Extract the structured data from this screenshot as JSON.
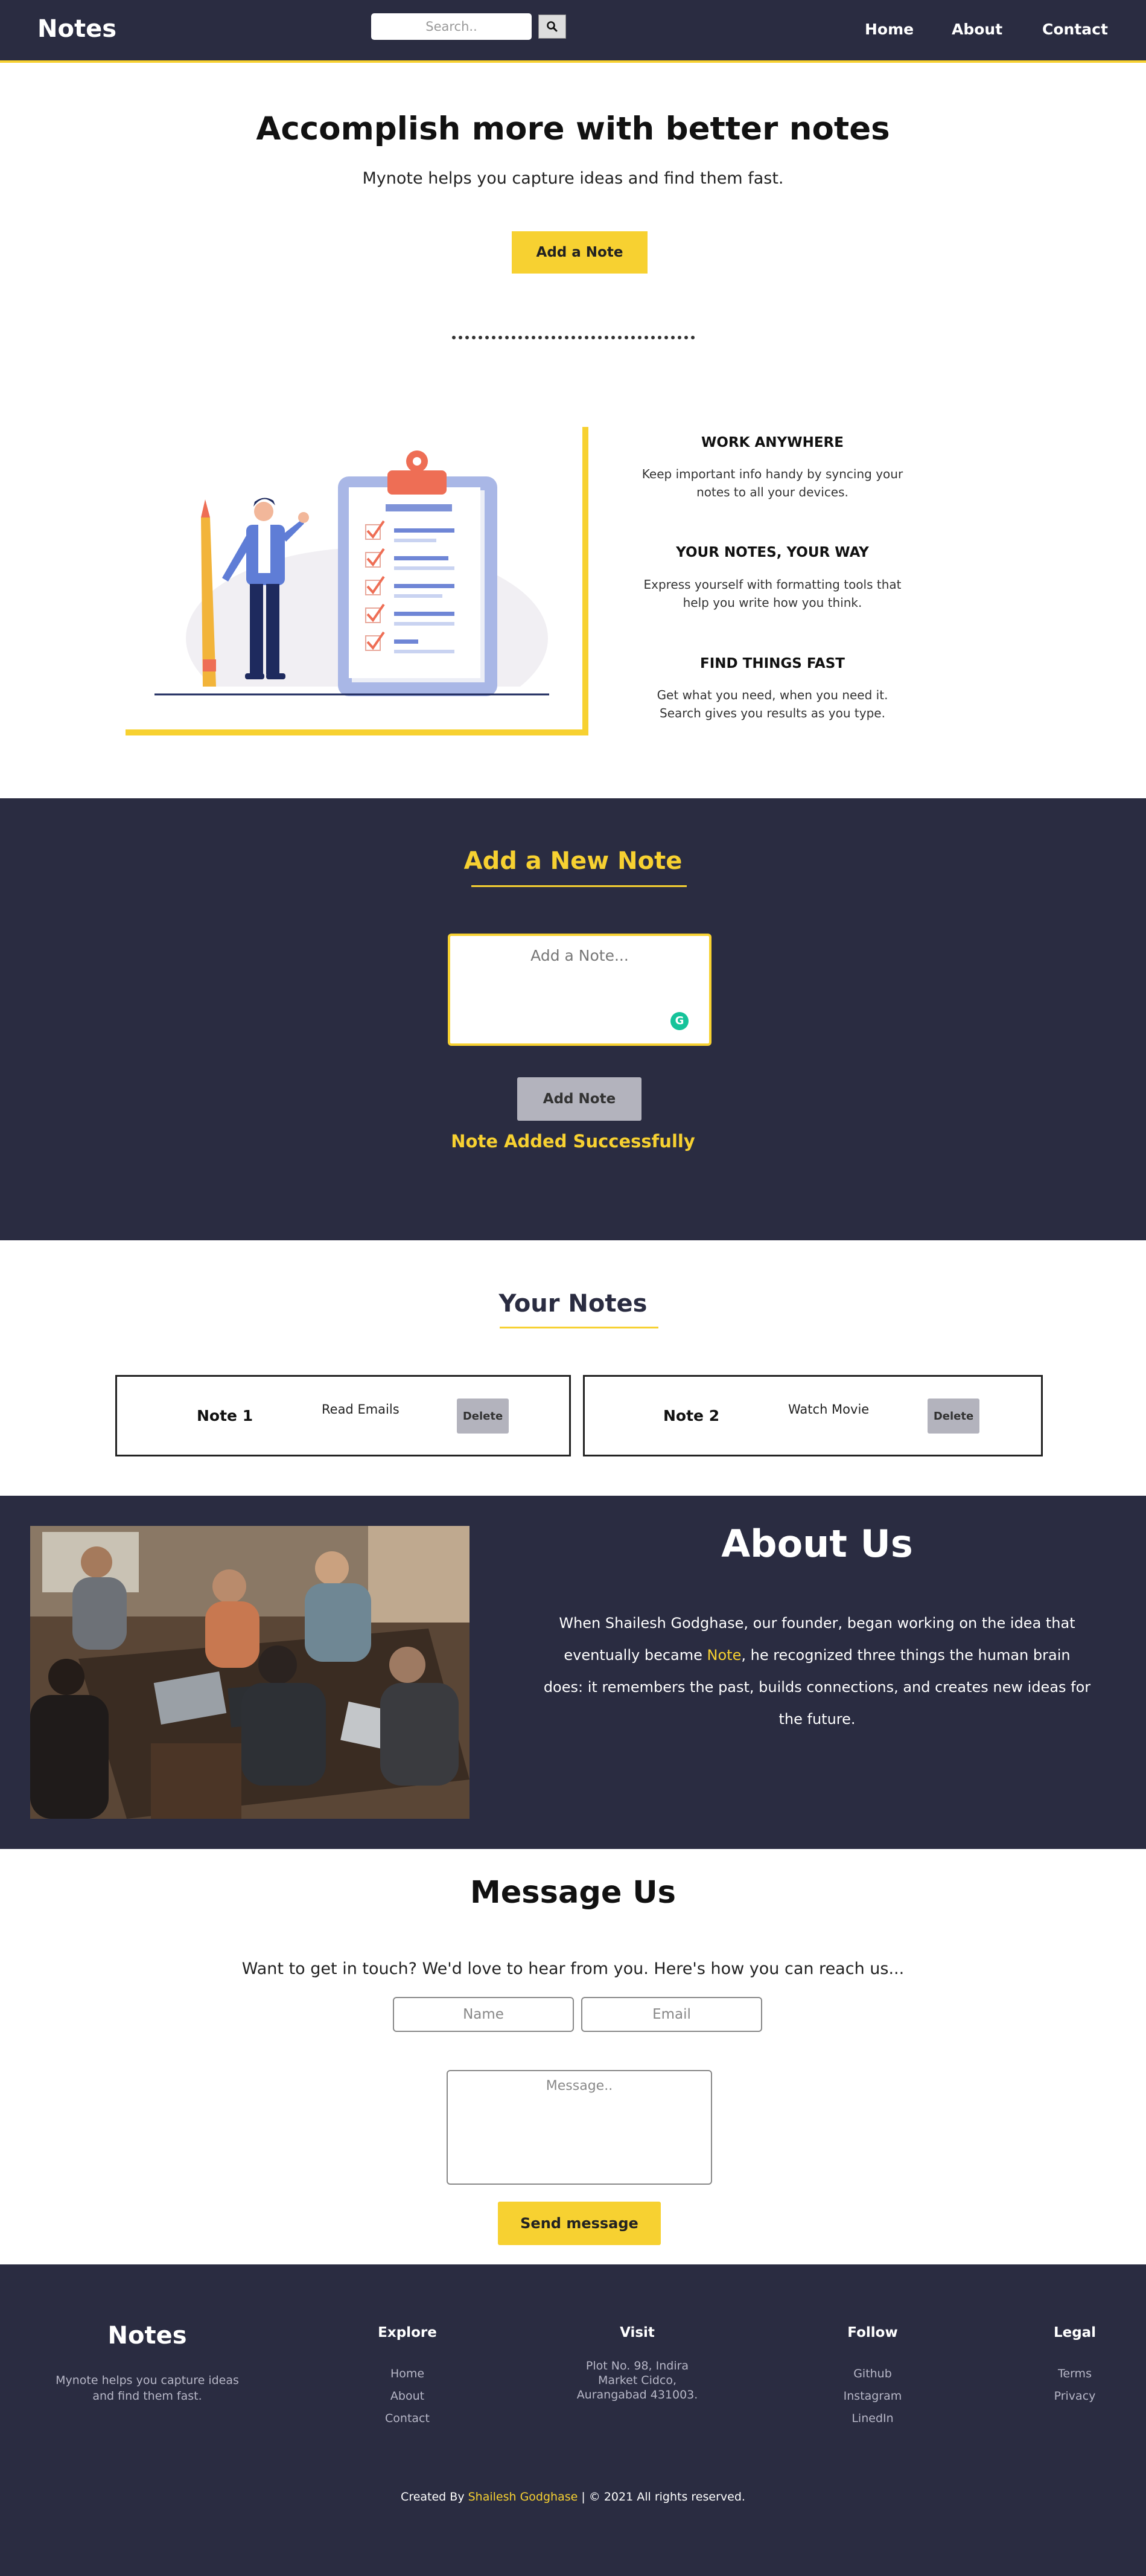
{
  "nav": {
    "brand": "Notes",
    "search_placeholder": "Search..",
    "links": [
      "Home",
      "About",
      "Contact"
    ]
  },
  "hero": {
    "title": "Accomplish more with better notes",
    "subtitle": "Mynote helps you capture ideas and find them fast.",
    "button": "Add a Note"
  },
  "features": [
    {
      "title": "WORK ANYWHERE",
      "text": "Keep important info handy by syncing your notes to all your devices."
    },
    {
      "title": "YOUR NOTES, YOUR WAY",
      "text": "Express yourself with formatting tools that help you write how you think."
    },
    {
      "title": "FIND THINGS FAST",
      "text": "Get what you need, when you need it. Search gives you results as you type."
    }
  ],
  "add_note": {
    "title": "Add a New Note",
    "placeholder": "Add a Note...",
    "grammarly_glyph": "G",
    "button": "Add Note",
    "status": "Note Added Successfully"
  },
  "your_notes": {
    "title": "Your Notes",
    "notes": [
      {
        "name": "Note 1",
        "body": "Read Emails",
        "delete": "Delete"
      },
      {
        "name": "Note 2",
        "body": "Watch Movie",
        "delete": "Delete"
      }
    ]
  },
  "about": {
    "title": "About Us",
    "text_before": "When Shailesh Godghase, our founder, began working on the idea that eventually became ",
    "highlight": "Note",
    "text_after": ", he recognized three things the human brain does: it remembers the past, builds connections, and creates new ideas for the future."
  },
  "message": {
    "title": "Message Us",
    "subtitle": "Want to get in touch? We'd love to hear from you. Here's how you can reach us...",
    "name_placeholder": "Name",
    "email_placeholder": "Email",
    "message_placeholder": "Message..",
    "button": "Send message"
  },
  "footer": {
    "brand": "Notes",
    "tagline": "Mynote helps you capture ideas and find them fast.",
    "explore": {
      "title": "Explore",
      "items": [
        "Home",
        "About",
        "Contact"
      ]
    },
    "visit": {
      "title": "Visit",
      "lines": [
        "Plot No. 98, Indira",
        "Market Cidco,",
        "Aurangabad 431003."
      ]
    },
    "follow": {
      "title": "Follow",
      "items": [
        "Github",
        "Instagram",
        "LinedIn"
      ]
    },
    "legal": {
      "title": "Legal",
      "items": [
        "Terms",
        "Privacy"
      ]
    },
    "copyright_prefix": "Created By ",
    "copyright_name": "Shailesh Godghase",
    "copyright_suffix": " | © 2021 All rights reserved."
  },
  "colors": {
    "navy": "#2a2c41",
    "accent": "#f7d131",
    "button_gray": "#b3b3bd"
  }
}
